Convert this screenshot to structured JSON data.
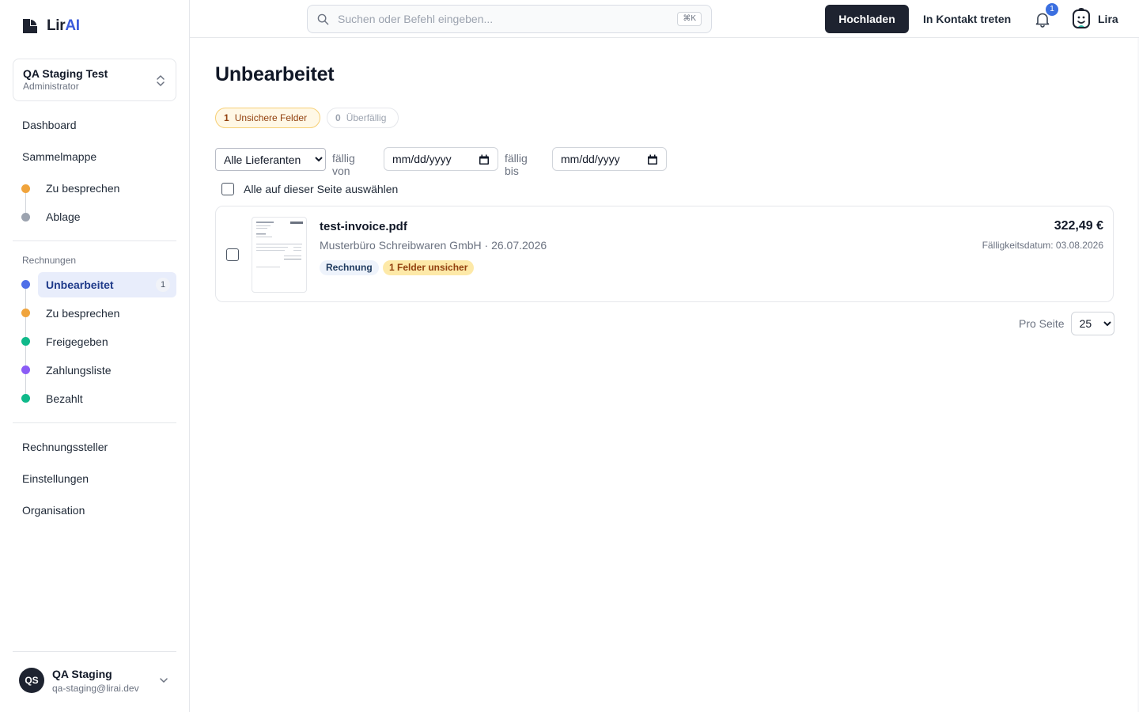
{
  "app": {
    "logo_prefix": "Lir",
    "logo_suffix": "AI"
  },
  "org_switcher": {
    "name": "QA Staging Test",
    "role": "Administrator"
  },
  "sidebar": {
    "nav_top": [
      {
        "label": "Dashboard"
      },
      {
        "label": "Sammelmappe"
      }
    ],
    "sammelmappe_items": [
      {
        "label": "Zu besprechen",
        "dot_color": "#f0a43c"
      },
      {
        "label": "Ablage",
        "dot_color": "#9ca3af"
      }
    ],
    "section_label": "Rechnungen",
    "invoice_items": [
      {
        "label": "Unbearbeitet",
        "dot_color": "#4f6fe8",
        "count": "1",
        "active": true
      },
      {
        "label": "Zu besprechen",
        "dot_color": "#f0a43c"
      },
      {
        "label": "Freigegeben",
        "dot_color": "#10b98a"
      },
      {
        "label": "Zahlungsliste",
        "dot_color": "#8b5cf6"
      },
      {
        "label": "Bezahlt",
        "dot_color": "#10b98a"
      }
    ],
    "nav_bottom": [
      {
        "label": "Rechnungssteller"
      },
      {
        "label": "Einstellungen"
      },
      {
        "label": "Organisation"
      }
    ]
  },
  "user": {
    "initials": "QS",
    "name": "QA Staging",
    "email": "qa-staging@lirai.dev"
  },
  "topbar": {
    "search_placeholder": "Suchen oder Befehl eingeben...",
    "search_shortcut": "⌘K",
    "upload_label": "Hochladen",
    "contact_label": "In Kontakt treten",
    "notification_count": "1",
    "assistant_label": "Lira"
  },
  "main": {
    "title": "Unbearbeitet",
    "pills": [
      {
        "count": "1",
        "label": "Unsichere Felder"
      },
      {
        "count": "0",
        "label": "Überfällig"
      }
    ],
    "filters": {
      "supplier_selected": "Alle Lieferanten",
      "due_from_label": "fällig von",
      "due_from_value": "mm/dd/yyyy",
      "due_to_label": "fällig bis",
      "due_to_value": "mm/dd/yyyy"
    },
    "select_all_label": "Alle auf dieser Seite auswählen",
    "invoices": [
      {
        "file_name": "test-invoice.pdf",
        "meta": "Musterbüro Schreibwaren GmbH · 26.07.2026",
        "type_tag": "Rechnung",
        "warning_tag": "1 Felder unsicher",
        "amount": "322,49 €",
        "due": "Fälligkeitsdatum: 03.08.2026"
      }
    ],
    "per_page_label": "Pro Seite",
    "per_page_value": "25"
  },
  "colors": {
    "brand_dark": "#1e2330",
    "accent_blue": "#3b5bdb",
    "warning": "#f6cf75"
  }
}
